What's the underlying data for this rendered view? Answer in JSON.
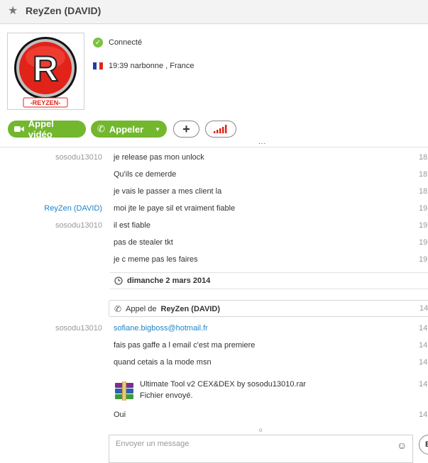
{
  "header": {
    "title": "ReyZen (DAVID)",
    "star_icon": "star-icon"
  },
  "profile": {
    "avatar_letter": "R",
    "avatar_caption": "-REYZEN-",
    "status": "Connecté",
    "location": "19:39 narbonne , France",
    "colors": {
      "status_green": "#7cc242",
      "avatar_red": "#e2231a"
    }
  },
  "actions": {
    "video_label": "Appel vidéo",
    "call_label": "Appeler",
    "add_icon": "plus-icon",
    "signal_icon": "signal-bars-icon",
    "more_dots": "...",
    "accent": "#73b72f"
  },
  "messages_a": [
    {
      "sender": "sosodu13010",
      "text": "je release pas mon unlock",
      "time": "18:"
    },
    {
      "sender": "",
      "text": "Qu'ils ce demerde",
      "time": "18:"
    },
    {
      "sender": "",
      "text": "je vais le passer a mes client la",
      "time": "18:"
    },
    {
      "sender": "ReyZen (DAVID)",
      "text": "moi jte le paye sil et vraiment fiable",
      "time": "19:"
    },
    {
      "sender": "sosodu13010",
      "text": "il est fiable",
      "time": "19:"
    },
    {
      "sender": "",
      "text": "pas de stealer tkt",
      "time": "19:"
    },
    {
      "sender": "",
      "text": "je c meme pas les faires",
      "time": "19:"
    }
  ],
  "date_separator": "dimanche 2 mars 2014",
  "call_event": {
    "prefix": "Appel de",
    "name": "ReyZen (DAVID)",
    "time": "14:"
  },
  "messages_b": [
    {
      "sender": "sosodu13010",
      "text": "sofiane.bigboss@hotmail.fr",
      "time": "14:"
    },
    {
      "sender": "",
      "text": "fais pas gaffe a l email c'est ma premiere",
      "time": "14:"
    },
    {
      "sender": "",
      "text": "quand cetais a la mode msn",
      "time": "14:"
    }
  ],
  "file_transfer": {
    "name": "Ultimate Tool v2 CEX&DEX by sosodu13010.rar",
    "status": "Fichier envoyé.",
    "time": "14:"
  },
  "last_message": {
    "text": "Oui",
    "time": "14:"
  },
  "composer": {
    "placeholder": "Envoyer un message",
    "send_label": "E"
  }
}
